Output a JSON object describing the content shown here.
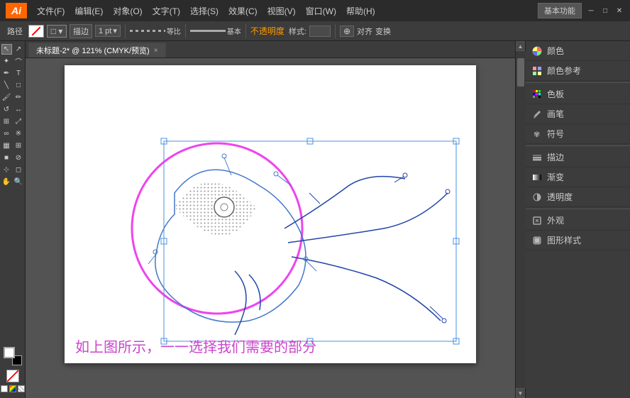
{
  "app": {
    "logo": "Ai",
    "title": "未标题-2* @ 121% (CMYK/预览)",
    "workspace": "基本功能",
    "tab_close": "×"
  },
  "menu": {
    "items": [
      "文件(F)",
      "编辑(E)",
      "对象(O)",
      "文字(T)",
      "选择(S)",
      "效果(C)",
      "视图(V)",
      "窗口(W)",
      "帮助(H)"
    ]
  },
  "toolbar": {
    "path_label": "路径",
    "stroke_size": "1 pt",
    "stroke_type1": "等比",
    "stroke_type2": "基本",
    "opacity_label": "不透明度",
    "style_label": "样式:",
    "align_label": "对齐",
    "transform_label": "变换"
  },
  "right_panel": {
    "items": [
      {
        "icon": "color-wheel",
        "label": "颜色"
      },
      {
        "icon": "color-ref",
        "label": "颜色参考"
      },
      {
        "icon": "swatch-grid",
        "label": "色板"
      },
      {
        "icon": "brush",
        "label": "画笔"
      },
      {
        "icon": "symbol",
        "label": "符号"
      },
      {
        "icon": "stroke-panel",
        "label": "描边"
      },
      {
        "icon": "gradient",
        "label": "渐变"
      },
      {
        "icon": "opacity",
        "label": "透明度"
      },
      {
        "icon": "appearance",
        "label": "外观"
      },
      {
        "icon": "graphic-style",
        "label": "图形样式"
      }
    ]
  },
  "canvas": {
    "caption": "如上图所示，一一选择我们需要的部分"
  },
  "colors": {
    "pink_circle": "#ee44ee",
    "blue_paths": "#4477cc",
    "selection": "#4a90e2",
    "dotted_fill": "#888"
  }
}
